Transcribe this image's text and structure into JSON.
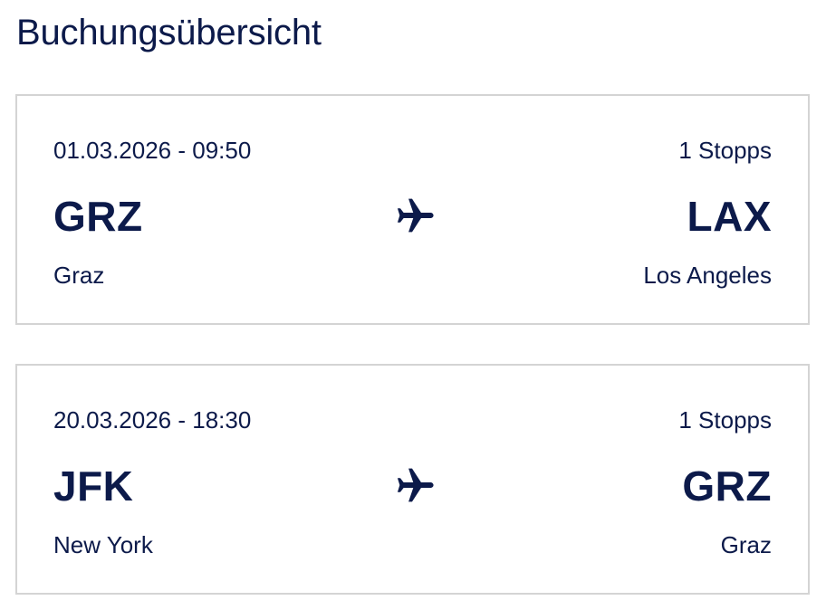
{
  "page": {
    "title": "Buchungsübersicht"
  },
  "colors": {
    "text": "#0c1a4a",
    "card_border": "#d4d4d4",
    "background": "#ffffff"
  },
  "flights": [
    {
      "datetime": "01.03.2026 - 09:50",
      "stops": "1 Stopps",
      "origin_code": "GRZ",
      "origin_city": "Graz",
      "destination_code": "LAX",
      "destination_city": "Los Angeles",
      "icon": "airplane-icon"
    },
    {
      "datetime": "20.03.2026 - 18:30",
      "stops": "1 Stopps",
      "origin_code": "JFK",
      "origin_city": "New York",
      "destination_code": "GRZ",
      "destination_city": "Graz",
      "icon": "airplane-icon"
    }
  ]
}
